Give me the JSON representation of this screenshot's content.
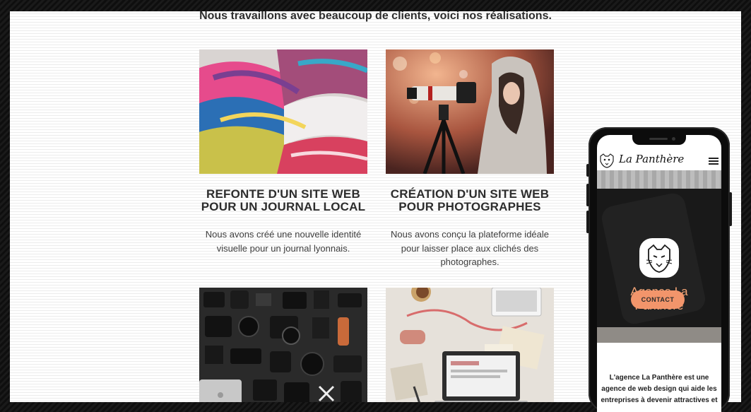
{
  "intro": "Nous travaillons avec beaucoup de clients, voici nos réalisations.",
  "projects": [
    {
      "image": "magazines-photo",
      "title_line1": "REFONTE D'UN SITE WEB",
      "title_line2": "POUR UN JOURNAL LOCAL",
      "desc_line1": "Nous avons créé une nouvelle identité",
      "desc_line2": "visuelle pour un journal lyonnais."
    },
    {
      "image": "photographer-photo",
      "title_line1": "CRÉATION D'UN SITE WEB",
      "title_line2": "POUR PHOTOGRAPHES",
      "desc_line1": "Nous avons conçu la plateforme idéale",
      "desc_line2": "pour laisser place aux clichés des",
      "desc_line3": "photographes."
    },
    {
      "image": "camera-gear-photo"
    },
    {
      "image": "workspace-photo"
    }
  ],
  "mobile": {
    "brand": "La Panthère",
    "hero_title_line1": "Agence La",
    "hero_title_line2": "Panthère",
    "cta": "CONTACT",
    "text_line1": "L'agence La Panthère est une",
    "text_line2": "agence de web design qui aide les",
    "text_line3": "entreprises à devenir attractives et"
  },
  "colors": {
    "accent": "#f2956b",
    "hero_title": "#f5a576",
    "heading": "#2d2d2d",
    "background": "#ffffff"
  }
}
